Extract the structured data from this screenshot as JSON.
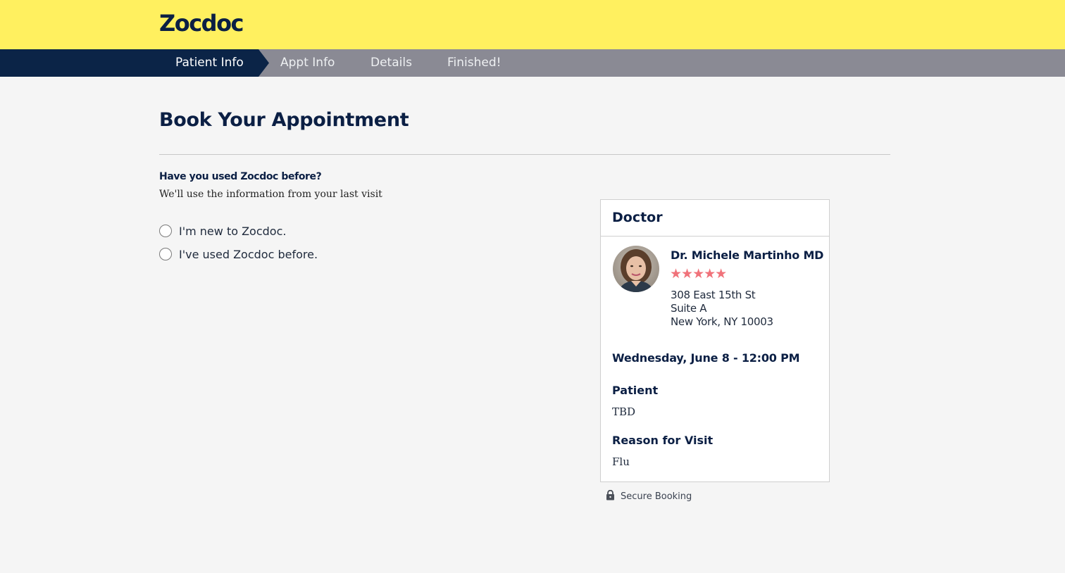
{
  "header": {
    "logo": "Zocdoc"
  },
  "steps": [
    {
      "label": "Patient Info",
      "active": true
    },
    {
      "label": "Appt Info",
      "active": false
    },
    {
      "label": "Details",
      "active": false
    },
    {
      "label": "Finished!",
      "active": false
    }
  ],
  "main": {
    "title": "Book Your Appointment",
    "question": "Have you used Zocdoc before?",
    "subtitle": "We'll use the information from your last visit",
    "options": [
      {
        "label": "I'm new to Zocdoc.",
        "checked": false
      },
      {
        "label": "I've used Zocdoc before.",
        "checked": false
      }
    ]
  },
  "card": {
    "title": "Doctor",
    "doctor_name": "Dr. Michele Martinho MD",
    "rating": 5,
    "stars": "★★★★★",
    "address": [
      "308 East 15th St",
      "Suite A",
      "New York, NY 10003"
    ],
    "appointment": "Wednesday, June 8 - 12:00 PM",
    "patient_label": "Patient",
    "patient_value": "TBD",
    "reason_label": "Reason for Visit",
    "reason_value": "Flu"
  },
  "footer": {
    "secure_label": "Secure Booking",
    "icon": "lock-icon"
  },
  "colors": {
    "header_bg": "#fff05f",
    "stepbar_bg": "#8a8a94",
    "step_active_bg": "#0b2447",
    "brand_navy": "#0b1f44",
    "star_color": "#f0727a"
  }
}
